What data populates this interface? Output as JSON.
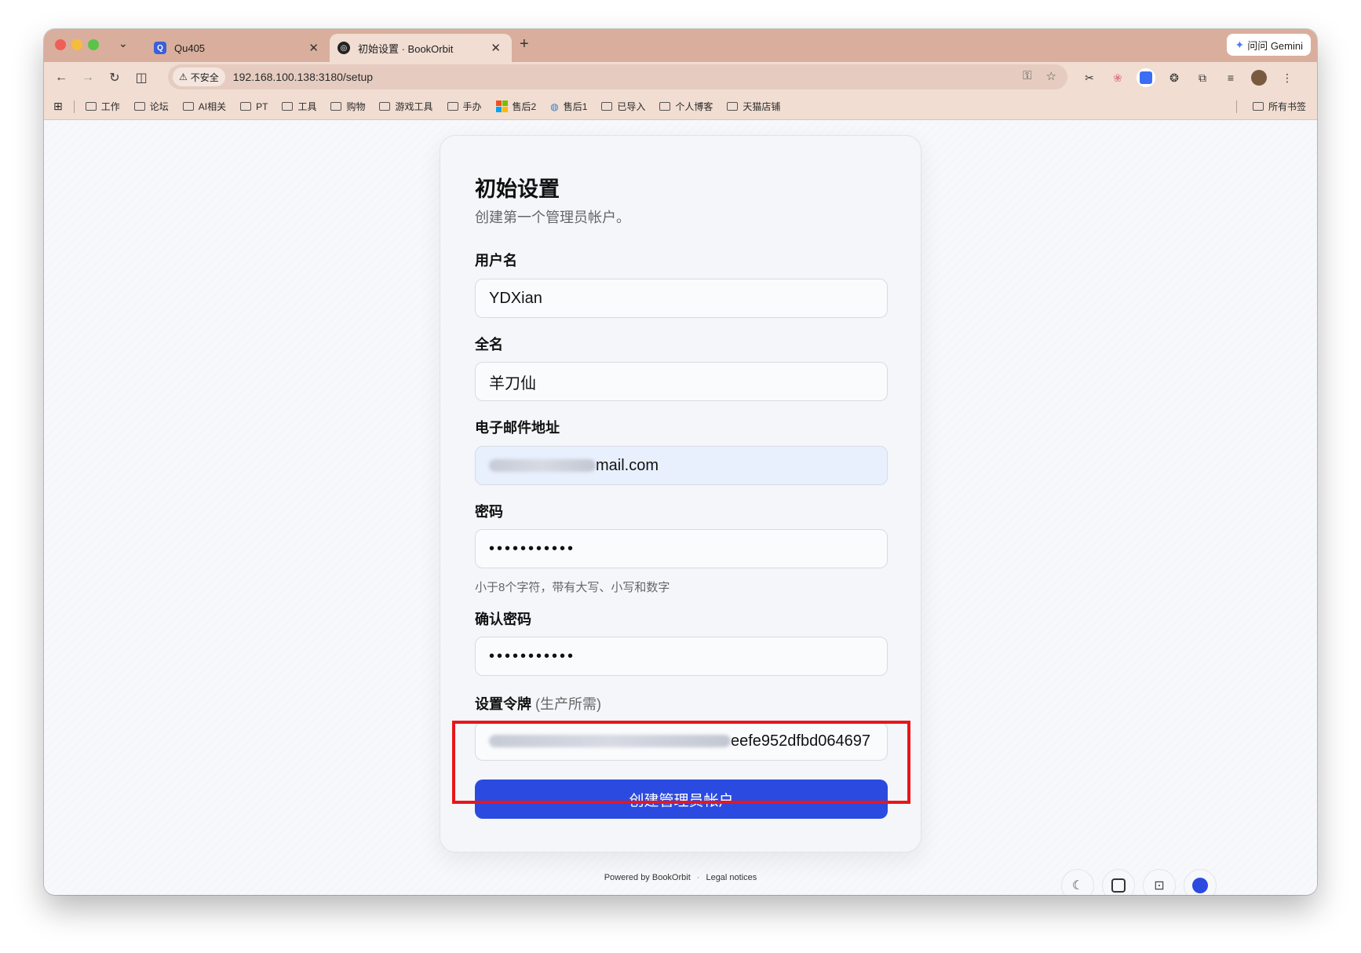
{
  "browser": {
    "tabs": [
      {
        "label": "Qu405",
        "active": false
      },
      {
        "label": "初始设置 · BookOrbit",
        "active": true
      }
    ],
    "new_tab_symbol": "+",
    "gemini_label": "问问 Gemini",
    "insecure_label": "不安全",
    "url": "192.168.100.138:3180/setup",
    "bookmarks": [
      "工作",
      "论坛",
      "AI相关",
      "PT",
      "工具",
      "购物",
      "游戏工具",
      "手办",
      "售后2",
      "售后1",
      "已导入",
      "个人博客",
      "天猫店铺"
    ],
    "all_bookmarks_label": "所有书签"
  },
  "setup": {
    "title": "初始设置",
    "subtitle": "创建第一个管理员帐户。",
    "username_label": "用户名",
    "username_value": "YDXian",
    "fullname_label": "全名",
    "fullname_value": "羊刀仙",
    "email_label": "电子邮件地址",
    "email_value_visible": "mail.com",
    "password_label": "密码",
    "password_value": "•••••••••••",
    "password_hint": "小于8个字符，带有大写、小写和数字",
    "confirm_label": "确认密码",
    "confirm_value": "•••••••••••",
    "token_label": "设置令牌",
    "token_label_suffix": "(生产所需)",
    "token_value_visible": "eefe952dfbd064697",
    "submit_label": "创建管理员帐户"
  },
  "footer": {
    "powered_by": "Powered by BookOrbit",
    "separator": "·",
    "legal": "Legal notices"
  },
  "colors": {
    "accent": "#2b4be0",
    "highlight": "#e8161b",
    "tabstrip": "#d9ae9c"
  }
}
